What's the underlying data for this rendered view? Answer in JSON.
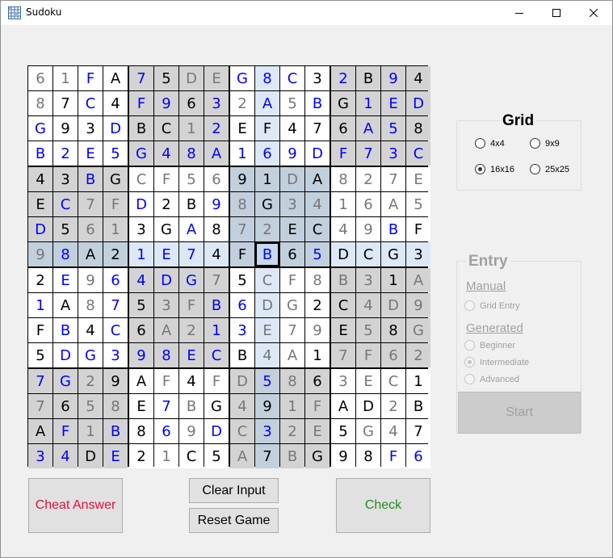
{
  "window": {
    "title": "Sudoku",
    "controls": {
      "minimize": "minimize-icon",
      "maximize": "maximize-icon",
      "close": "close-icon"
    }
  },
  "colors": {
    "given": "#000000",
    "user_entry": "#0000ff",
    "hint": "#777777",
    "cell_white": "#ffffff",
    "cell_gray": "#d3d3d3",
    "cell_highlight": "#dce8f5",
    "cell_highlight_gray": "#c2cfdc",
    "cheat_text": "#dc143c",
    "check_text": "#228b22",
    "disabled_text": "#a0a0a0"
  },
  "board": {
    "size": 16,
    "selected_row": 7,
    "selected_col": 9,
    "rows": [
      "61FA75DEG8C32B94",
      "87C4F963 2A5BG1ED",
      "G93DBC12EF476A58",
      "B2E5G48A169DF73C",
      "43BGCF5691DA827E",
      "EC7FD2B98G341 6A5",
      "D5613GA872EC49BF",
      "98A21E74FB65DCG3",
      "2E964DG75CF8B31A",
      "1A8753FB6DG2C4D9",
      "FB4C6A213E79E58G",
      "5DG398ECB4A17F62",
      "7G29AF4FD5863EC1",
      "7658E7BG491FAD2B",
      "AF1B869DC32E5G47",
      "34DE21C5A7BG98F6"
    ],
    "cells": [
      [
        "6",
        "1",
        "F",
        "A",
        "7",
        "5",
        "D",
        "E",
        "G",
        "8",
        "C",
        "3",
        "2",
        "B",
        "9",
        "4"
      ],
      [
        "8",
        "7",
        "C",
        "4",
        "F",
        "9",
        "6",
        "3",
        "2",
        "A",
        "5",
        "B",
        "G",
        "1",
        "E",
        "D"
      ],
      [
        "G",
        "9",
        "3",
        "D",
        "B",
        "C",
        "1",
        "2",
        "E",
        "F",
        "4",
        "7",
        "6",
        "A",
        "5",
        "8"
      ],
      [
        "B",
        "2",
        "E",
        "5",
        "G",
        "4",
        "8",
        "A",
        "1",
        "6",
        "9",
        "D",
        "F",
        "7",
        "3",
        "C"
      ],
      [
        "4",
        "3",
        "B",
        "G",
        "C",
        "F",
        "5",
        "6",
        "9",
        "1",
        "D",
        "A",
        "8",
        "2",
        "7",
        "E"
      ],
      [
        "E",
        "C",
        "7",
        "F",
        "D",
        "2",
        "B",
        "9",
        "8",
        "G",
        "3",
        "4",
        "1",
        "6",
        "A",
        "5"
      ],
      [
        "D",
        "5",
        "6",
        "1",
        "3",
        "G",
        "A",
        "8",
        "7",
        "2",
        "E",
        "C",
        "4",
        "9",
        "B",
        "F"
      ],
      [
        "9",
        "8",
        "A",
        "2",
        "1",
        "E",
        "7",
        "4",
        "F",
        "B",
        "6",
        "5",
        "D",
        "C",
        "G",
        "3"
      ],
      [
        "2",
        "E",
        "9",
        "6",
        "4",
        "D",
        "G",
        "7",
        "5",
        "C",
        "F",
        "8",
        "B",
        "3",
        "1",
        "A"
      ],
      [
        "1",
        "A",
        "8",
        "7",
        "5",
        "3",
        "F",
        "B",
        "6",
        "D",
        "G",
        "2",
        "C",
        "4",
        "D",
        "9"
      ],
      [
        "F",
        "B",
        "4",
        "C",
        "6",
        "A",
        "2",
        "1",
        "3",
        "E",
        "7",
        "9",
        "E",
        "5",
        "8",
        "G"
      ],
      [
        "5",
        "D",
        "G",
        "3",
        "9",
        "8",
        "E",
        "C",
        "B",
        "4",
        "A",
        "1",
        "7",
        "F",
        "6",
        "2"
      ],
      [
        "7",
        "G",
        "2",
        "9",
        "A",
        "F",
        "4",
        "F",
        "D",
        "5",
        "8",
        "6",
        "3",
        "E",
        "C",
        "1"
      ],
      [
        "7",
        "6",
        "5",
        "8",
        "E",
        "7",
        "B",
        "G",
        "4",
        "9",
        "1",
        "F",
        "A",
        "D",
        "2",
        "B"
      ],
      [
        "A",
        "F",
        "1",
        "B",
        "8",
        "6",
        "9",
        "D",
        "C",
        "3",
        "2",
        "E",
        "5",
        "G",
        "4",
        "7"
      ],
      [
        "3",
        "4",
        "D",
        "E",
        "2",
        "1",
        "C",
        "5",
        "A",
        "7",
        "B",
        "G",
        "9",
        "8",
        "F",
        "6"
      ]
    ],
    "styles": [
      [
        "h",
        "h",
        "u",
        "g",
        "u",
        "g",
        "h",
        "h",
        "u",
        "u",
        "u",
        "g",
        "u",
        "g",
        "u",
        "g"
      ],
      [
        "h",
        "g",
        "u",
        "g",
        "u",
        "u",
        "g",
        "u",
        "h",
        "u",
        "h",
        "u",
        "g",
        "u",
        "u",
        "u"
      ],
      [
        "u",
        "g",
        "g",
        "u",
        "g",
        "g",
        "h",
        "u",
        "g",
        "g",
        "g",
        "g",
        "g",
        "u",
        "u",
        "g"
      ],
      [
        "u",
        "u",
        "u",
        "u",
        "u",
        "u",
        "u",
        "u",
        "u",
        "u",
        "u",
        "u",
        "u",
        "u",
        "u",
        "u"
      ],
      [
        "g",
        "g",
        "u",
        "g",
        "h",
        "h",
        "h",
        "h",
        "g",
        "g",
        "h",
        "g",
        "h",
        "h",
        "h",
        "h"
      ],
      [
        "g",
        "u",
        "h",
        "h",
        "u",
        "g",
        "g",
        "u",
        "h",
        "g",
        "h",
        "h",
        "h",
        "h",
        "h",
        "h"
      ],
      [
        "u",
        "g",
        "h",
        "h",
        "g",
        "g",
        "u",
        "g",
        "h",
        "h",
        "g",
        "g",
        "h",
        "h",
        "u",
        "g"
      ],
      [
        "h",
        "u",
        "g",
        "g",
        "u",
        "u",
        "u",
        "g",
        "g",
        "u",
        "g",
        "u",
        "g",
        "g",
        "g",
        "g"
      ],
      [
        "g",
        "u",
        "h",
        "u",
        "u",
        "u",
        "u",
        "h",
        "g",
        "h",
        "h",
        "h",
        "h",
        "h",
        "g",
        "h"
      ],
      [
        "u",
        "g",
        "h",
        "u",
        "g",
        "h",
        "h",
        "u",
        "u",
        "h",
        "h",
        "g",
        "g",
        "h",
        "h",
        "h"
      ],
      [
        "g",
        "u",
        "g",
        "u",
        "g",
        "h",
        "h",
        "u",
        "u",
        "h",
        "h",
        "h",
        "g",
        "h",
        "g",
        "h"
      ],
      [
        "g",
        "u",
        "u",
        "u",
        "u",
        "u",
        "u",
        "u",
        "g",
        "h",
        "h",
        "g",
        "h",
        "h",
        "h",
        "h"
      ],
      [
        "u",
        "u",
        "h",
        "g",
        "g",
        "h",
        "g",
        "h",
        "h",
        "u",
        "h",
        "g",
        "h",
        "h",
        "h",
        "g"
      ],
      [
        "h",
        "g",
        "h",
        "h",
        "g",
        "u",
        "h",
        "g",
        "h",
        "g",
        "h",
        "h",
        "g",
        "g",
        "h",
        "g"
      ],
      [
        "g",
        "u",
        "h",
        "u",
        "g",
        "u",
        "h",
        "u",
        "h",
        "u",
        "h",
        "h",
        "g",
        "h",
        "h",
        "g"
      ],
      [
        "u",
        "u",
        "g",
        "u",
        "g",
        "h",
        "g",
        "g",
        "h",
        "g",
        "h",
        "g",
        "g",
        "g",
        "u",
        "u"
      ]
    ],
    "shading": [
      "wwwwgggggwwwgwgg",
      "wwwwggggwwwwgwgg",
      "wwwwggggwwwwgwgg",
      "wwwwggggwwwwgwgg",
      "ggggwwwwbbbbwwww",
      "ggggwwwwbbbbwwww",
      "ggggwwwwbbbbwwww",
      "bbbbbbbbbsbbbbbb",
      "wwwwggggwbbwggggg",
      "wwwwggggwbbwgggg",
      "wwwwggggwbbwgggg",
      "wwwwggggwbbwgggg",
      "ggggwwwwgbbgwwww",
      "ggggwwwwgbbgwwww",
      "ggggwwwwgbbgwwww",
      "ggggwwwwgbbgwwww"
    ]
  },
  "buttons": {
    "cheat": "Cheat Answer",
    "clear": "Clear Input",
    "reset": "Reset Game",
    "check": "Check",
    "start": "Start"
  },
  "grid_group": {
    "title": "Grid",
    "options": [
      {
        "label": "4x4",
        "checked": false
      },
      {
        "label": "9x9",
        "checked": false
      },
      {
        "label": "16x16",
        "checked": true
      },
      {
        "label": "25x25",
        "checked": false
      }
    ]
  },
  "entry_group": {
    "title": "Entry",
    "manual_label": "Manual",
    "manual_options": [
      {
        "label": "Grid Entry",
        "checked": false
      }
    ],
    "generated_label": "Generated",
    "generated_options": [
      {
        "label": "Beginner",
        "checked": false
      },
      {
        "label": "Intermediate",
        "checked": true
      },
      {
        "label": "Advanced",
        "checked": false
      }
    ]
  }
}
